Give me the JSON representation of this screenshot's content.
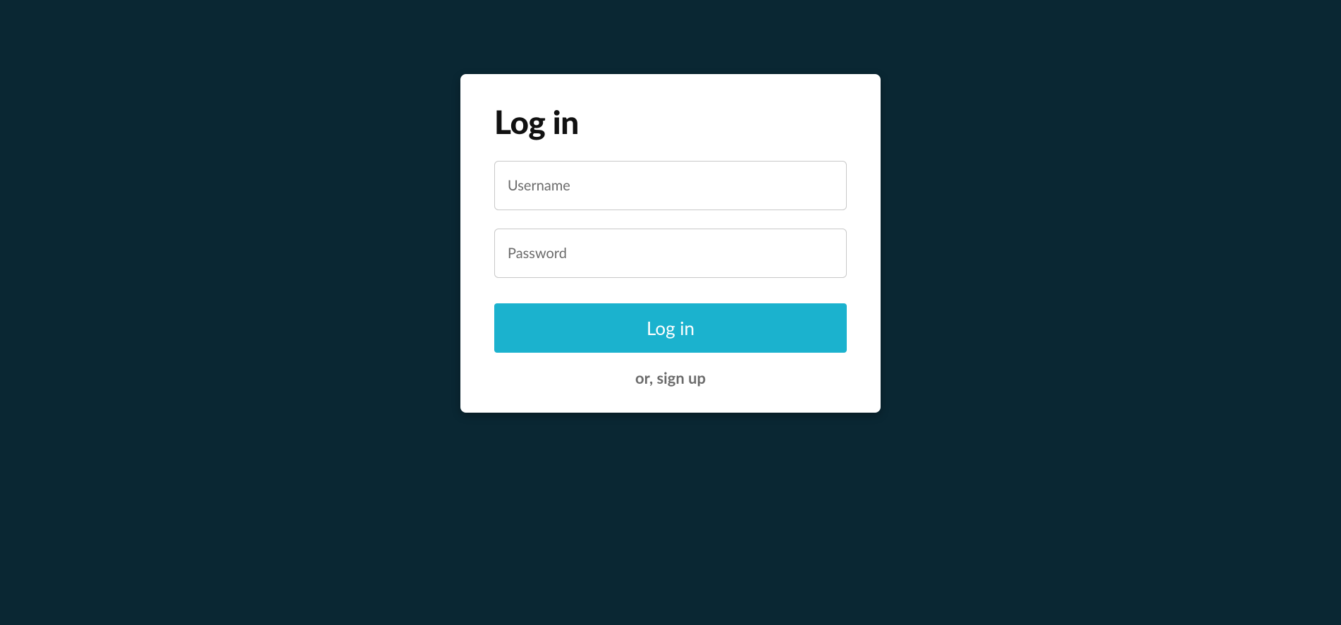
{
  "login": {
    "title": "Log in",
    "username_placeholder": "Username",
    "password_placeholder": "Password",
    "button_label": "Log in",
    "signup_text": "or, sign up"
  }
}
